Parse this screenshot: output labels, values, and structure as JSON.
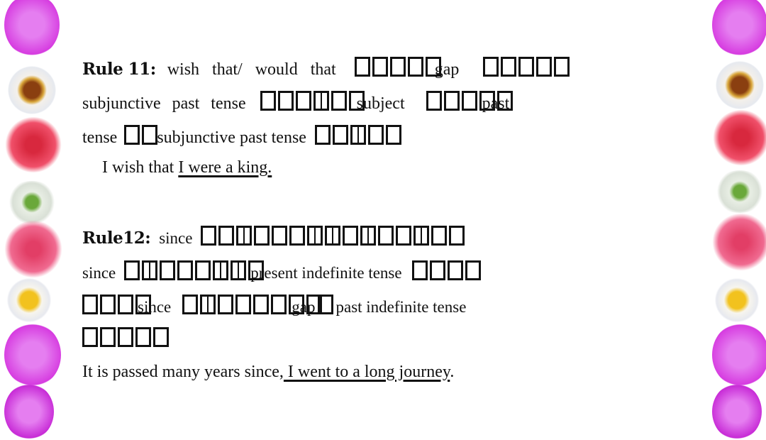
{
  "slide": {
    "rule11": {
      "label": "Rule 11:",
      "line1_text_a": "wish that/ would that",
      "line1_boxes_a": 5,
      "line1_text_b": "gap",
      "line1_boxes_b": 5,
      "line2_text_a": "subjunctive past tense",
      "line2_boxes_a": 6,
      "line2_text_b": "subject",
      "line2_boxes_b": 5,
      "line2_text_c": "past",
      "line3_text_a": "tense",
      "line3_boxes_a": 2,
      "line3_text_b": "subjunctive past tense",
      "line3_boxes_b": 5,
      "example_prefix": "I wish that",
      "example_underlined": "I were a king."
    },
    "rule12": {
      "label": "Rule12:",
      "line1_text_a": "since",
      "line1_boxes_a": 15,
      "line2_text_a": "since",
      "line2_boxes_a": 8,
      "line2_text_b": "present indefinite tense",
      "line2_boxes_b": 4,
      "line3_boxes_a": 4,
      "line3_text_a": "since",
      "line3_boxes_b": 8,
      "line3_text_b": "gap",
      "line3_boxes_c": 1,
      "line3_text_c": "past indefinite tense",
      "line4_boxes_a": 5,
      "example_prefix": "It is passed many years since,",
      "example_underlined": " I went to a long journey",
      "example_suffix": "."
    },
    "decoration": {
      "border_icons": [
        "purple-flower",
        "daisy-brown",
        "red-rose",
        "green-bud",
        "pink-rose",
        "daisy-yellow",
        "purple-flower"
      ],
      "colors": {
        "purple": "#d63be0",
        "rose": "#f0506a",
        "pink": "#f06a90",
        "daisy_center": "#a8561a",
        "yellow": "#f2c21e",
        "green": "#6aa83a"
      }
    }
  }
}
